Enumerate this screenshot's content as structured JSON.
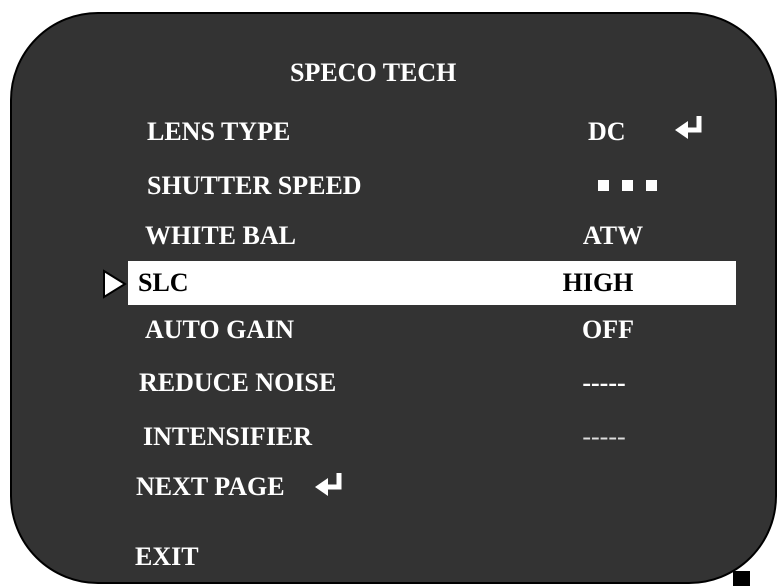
{
  "title": "SPECO  TECH",
  "menu": [
    {
      "label": "LENS  TYPE",
      "value": "DC",
      "icon": "enter-arrow-icon"
    },
    {
      "label": "SHUTTER SPEED",
      "value_icon": "three-squares-icon"
    },
    {
      "label": "WHITE BAL",
      "value": "ATW"
    },
    {
      "label": "SLC",
      "value": "HIGH",
      "selected": true
    },
    {
      "label": "AUTO GAIN",
      "value": "OFF"
    },
    {
      "label": "REDUCE NOISE",
      "value": "-----"
    },
    {
      "label": "INTENSIFIER",
      "value": "-----"
    },
    {
      "label": "NEXT PAGE",
      "icon": "enter-arrow-icon"
    },
    {
      "label": "EXIT"
    }
  ],
  "colors": {
    "panel": "#333333",
    "text": "#ffffff",
    "selection": "#ffffff",
    "selected_text": "#000000"
  }
}
